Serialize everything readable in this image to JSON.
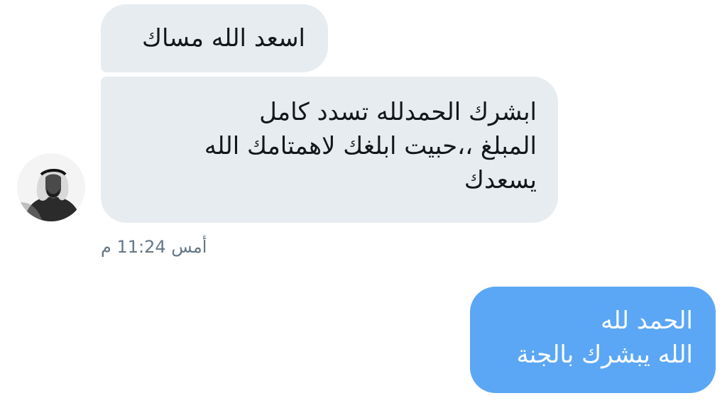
{
  "conversation": {
    "messages": [
      {
        "direction": "received",
        "text": "اسعد الله مساك"
      },
      {
        "direction": "received",
        "text": "ابشرك الحمدلله تسدد كامل\nالمبلغ ،،حبيت ابلغك لاهمتامك الله\nيسعدك"
      },
      {
        "direction": "sent",
        "text": "الحمد لله\nالله يبشرك بالجنة"
      }
    ],
    "timestamp": "أمس 11:24 م"
  },
  "colors": {
    "received_bubble": "#e6ecf0",
    "sent_bubble": "#5ba7f5",
    "timestamp_text": "#657786"
  },
  "icons": {
    "avatar": "profile-photo-grayscale"
  }
}
